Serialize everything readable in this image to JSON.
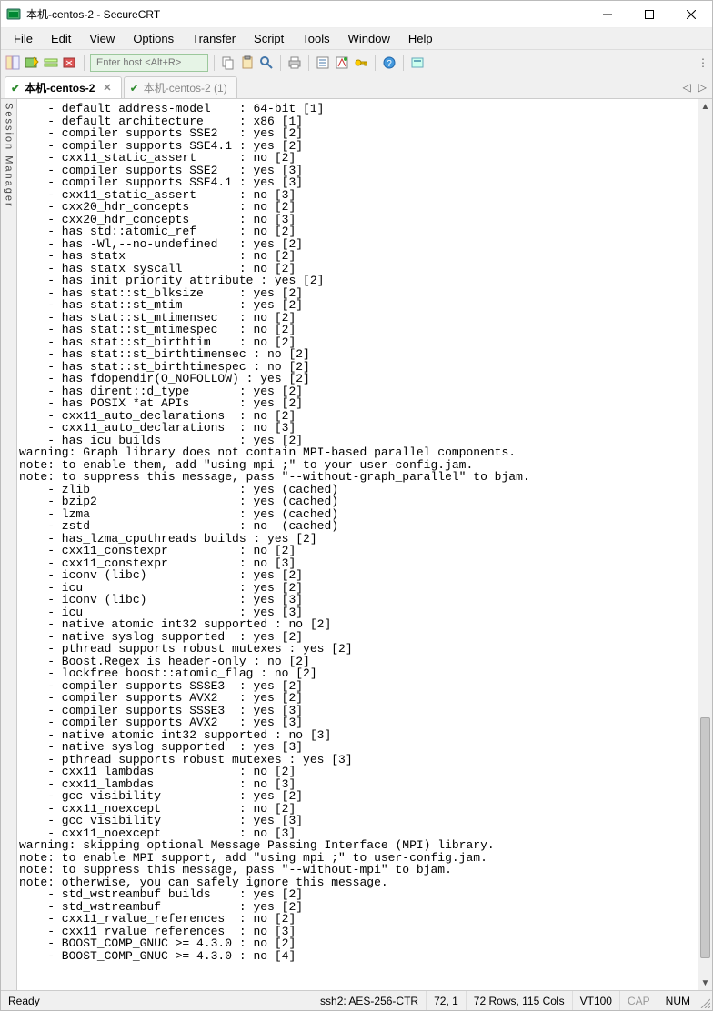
{
  "window": {
    "title": "本机-centos-2 - SecureCRT"
  },
  "menubar": {
    "items": [
      "File",
      "Edit",
      "View",
      "Options",
      "Transfer",
      "Script",
      "Tools",
      "Window",
      "Help"
    ]
  },
  "toolbar": {
    "host_placeholder": "Enter host <Alt+R>"
  },
  "tabs": {
    "items": [
      {
        "label": "本机-centos-2",
        "active": true
      },
      {
        "label": "本机-centos-2 (1)",
        "active": false
      }
    ]
  },
  "sessmgr": {
    "label": "Session Manager"
  },
  "terminal": {
    "lines": [
      "    - default address-model    : 64-bit [1]",
      "    - default architecture     : x86 [1]",
      "    - compiler supports SSE2   : yes [2]",
      "    - compiler supports SSE4.1 : yes [2]",
      "    - cxx11_static_assert      : no [2]",
      "    - compiler supports SSE2   : yes [3]",
      "    - compiler supports SSE4.1 : yes [3]",
      "    - cxx11_static_assert      : no [3]",
      "    - cxx20_hdr_concepts       : no [2]",
      "    - cxx20_hdr_concepts       : no [3]",
      "    - has std::atomic_ref      : no [2]",
      "    - has -Wl,--no-undefined   : yes [2]",
      "    - has statx                : no [2]",
      "    - has statx syscall        : no [2]",
      "    - has init_priority attribute : yes [2]",
      "    - has stat::st_blksize     : yes [2]",
      "    - has stat::st_mtim        : yes [2]",
      "    - has stat::st_mtimensec   : no [2]",
      "    - has stat::st_mtimespec   : no [2]",
      "    - has stat::st_birthtim    : no [2]",
      "    - has stat::st_birthtimensec : no [2]",
      "    - has stat::st_birthtimespec : no [2]",
      "    - has fdopendir(O_NOFOLLOW) : yes [2]",
      "    - has dirent::d_type       : yes [2]",
      "    - has POSIX *at APIs       : yes [2]",
      "    - cxx11_auto_declarations  : no [2]",
      "    - cxx11_auto_declarations  : no [3]",
      "    - has_icu builds           : yes [2]",
      "warning: Graph library does not contain MPI-based parallel components.",
      "note: to enable them, add \"using mpi ;\" to your user-config.jam.",
      "note: to suppress this message, pass \"--without-graph_parallel\" to bjam.",
      "    - zlib                     : yes (cached)",
      "    - bzip2                    : yes (cached)",
      "    - lzma                     : yes (cached)",
      "    - zstd                     : no  (cached)",
      "    - has_lzma_cputhreads builds : yes [2]",
      "    - cxx11_constexpr          : no [2]",
      "    - cxx11_constexpr          : no [3]",
      "    - iconv (libc)             : yes [2]",
      "    - icu                      : yes [2]",
      "    - iconv (libc)             : yes [3]",
      "    - icu                      : yes [3]",
      "    - native atomic int32 supported : no [2]",
      "    - native syslog supported  : yes [2]",
      "    - pthread supports robust mutexes : yes [2]",
      "    - Boost.Regex is header-only : no [2]",
      "    - lockfree boost::atomic_flag : no [2]",
      "    - compiler supports SSSE3  : yes [2]",
      "    - compiler supports AVX2   : yes [2]",
      "    - compiler supports SSSE3  : yes [3]",
      "    - compiler supports AVX2   : yes [3]",
      "    - native atomic int32 supported : no [3]",
      "    - native syslog supported  : yes [3]",
      "    - pthread supports robust mutexes : yes [3]",
      "    - cxx11_lambdas            : no [2]",
      "    - cxx11_lambdas            : no [3]",
      "    - gcc visibility           : yes [2]",
      "    - cxx11_noexcept           : no [2]",
      "    - gcc visibility           : yes [3]",
      "    - cxx11_noexcept           : no [3]",
      "warning: skipping optional Message Passing Interface (MPI) library.",
      "note: to enable MPI support, add \"using mpi ;\" to user-config.jam.",
      "note: to suppress this message, pass \"--without-mpi\" to bjam.",
      "note: otherwise, you can safely ignore this message.",
      "    - std_wstreambuf builds    : yes [2]",
      "    - std_wstreambuf           : yes [2]",
      "    - cxx11_rvalue_references  : no [2]",
      "    - cxx11_rvalue_references  : no [3]",
      "    - BOOST_COMP_GNUC >= 4.3.0 : no [2]",
      "    - BOOST_COMP_GNUC >= 4.3.0 : no [4]"
    ]
  },
  "status": {
    "ready": "Ready",
    "protocol": "ssh2: AES-256-CTR",
    "cursor": "72,  1",
    "dims": "72 Rows, 115 Cols",
    "term": "VT100",
    "cap": "CAP",
    "num": "NUM"
  }
}
